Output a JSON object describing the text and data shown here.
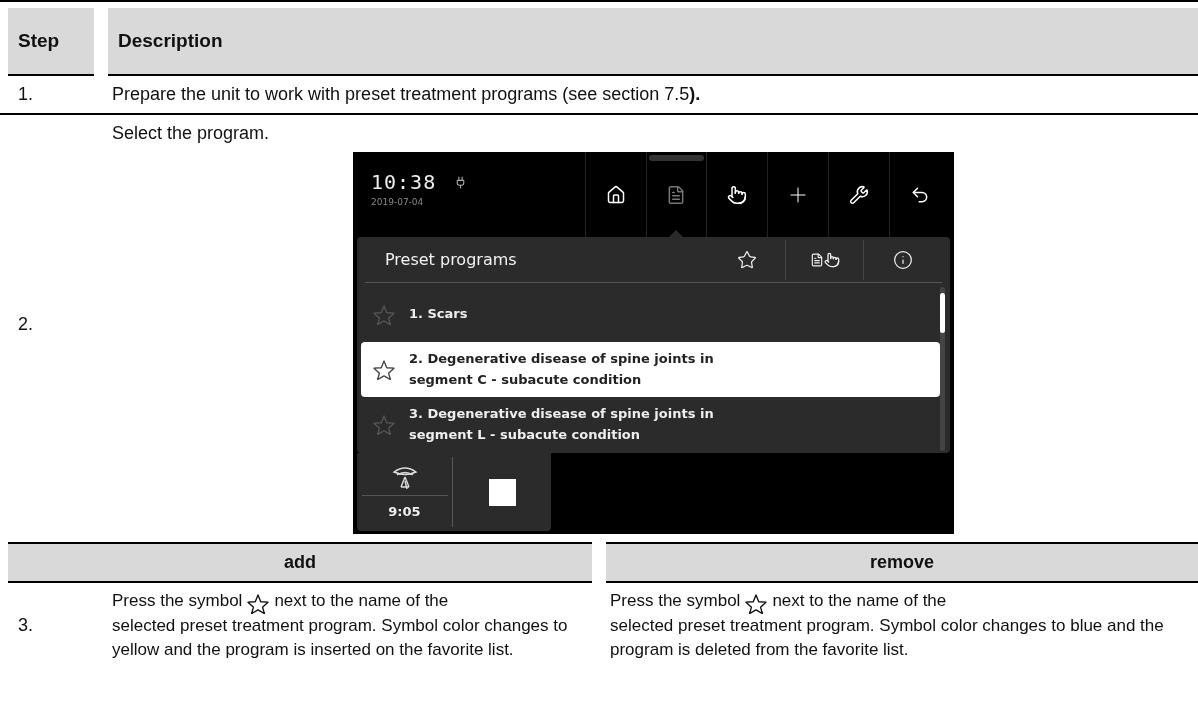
{
  "header": {
    "step": "Step",
    "description": "Description"
  },
  "step1": {
    "number": "1.",
    "text": "Prepare the unit to work with preset treatment programs (see section 7.5**).**"
  },
  "step2": {
    "number": "2.",
    "text": "Select the program.",
    "device": {
      "time": "10:38",
      "date": "2019-07-04",
      "nav": [
        {
          "kind": "home",
          "selected": false
        },
        {
          "kind": "programs",
          "selected": true
        },
        {
          "kind": "manual",
          "selected": false
        },
        {
          "kind": "add",
          "selected": false
        },
        {
          "kind": "service",
          "selected": false
        },
        {
          "kind": "back",
          "selected": false
        }
      ],
      "panel": {
        "title": "Preset programs",
        "items": [
          {
            "label": "1. Scars",
            "selected": false
          },
          {
            "label": "2. Degenerative disease of spine joints in segment C - subacute condition",
            "selected": true
          },
          {
            "label": "3. Degenerative disease of spine joints in segment L - subacute condition",
            "selected": false
          }
        ]
      },
      "timer": "9:05"
    }
  },
  "step3": {
    "number": "3.",
    "columns": [
      {
        "heading": "add",
        "before": "Press the symbol",
        "after": "next to the name of the",
        "rest": "selected preset treatment program. Symbol color changes to yellow and the program is inserted on the favorite list."
      },
      {
        "heading": "remove",
        "before": "Press the symbol",
        "after": "next to the name of the",
        "rest": "selected preset treatment program. Symbol color changes to blue and the program is deleted from the favorite list."
      }
    ]
  }
}
